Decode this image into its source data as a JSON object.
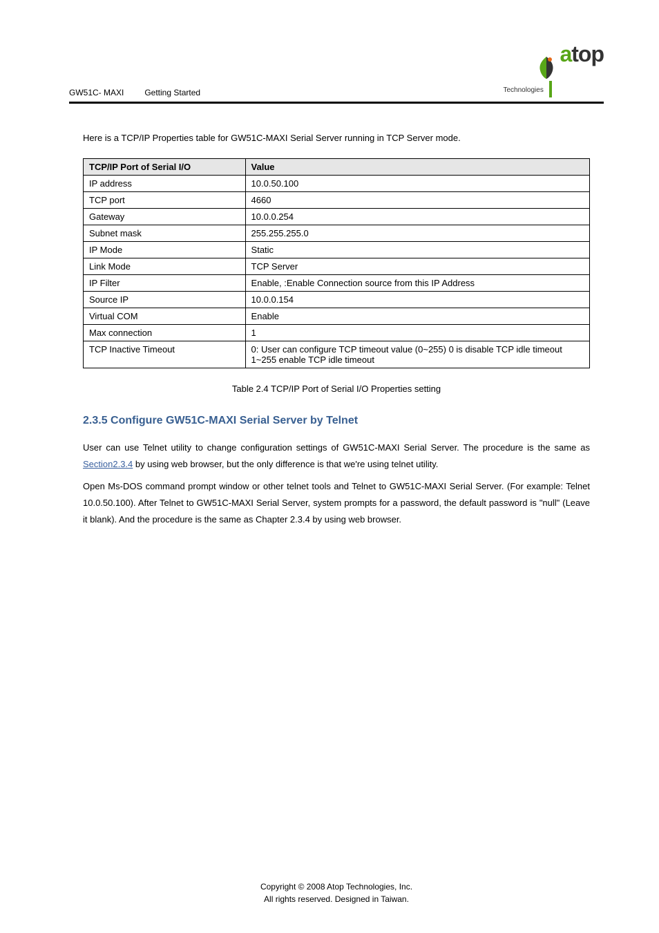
{
  "header": {
    "product": "GW51C- MAXI",
    "doc_title": "Getting Started",
    "logo_brand_a": "a",
    "logo_brand_top": "top",
    "logo_subtitle": "Technologies"
  },
  "intro": "Here is a TCP/IP Properties table for GW51C-MAXI Serial Server running in TCP Server mode.",
  "table": {
    "th_setting": "TCP/IP Port of Serial I/O",
    "th_value": "Value",
    "rows": [
      [
        "IP address",
        "10.0.50.100"
      ],
      [
        "TCP port",
        "4660"
      ],
      [
        "Gateway",
        "10.0.0.254"
      ],
      [
        "Subnet mask",
        "255.255.255.0"
      ],
      [
        "IP Mode",
        "Static"
      ],
      [
        "Link Mode",
        "TCP Server"
      ],
      [
        "IP Filter",
        "Enable, :Enable Connection source from this IP Address"
      ],
      [
        "Source IP",
        "10.0.0.154"
      ],
      [
        "Virtual COM",
        "Enable"
      ],
      [
        "Max connection",
        "1"
      ],
      [
        "TCP Inactive Timeout",
        "0: User can configure TCP timeout value (0~255) 0 is disable TCP idle timeout 1~255 enable TCP idle timeout"
      ]
    ]
  },
  "caption": "Table 2.4 TCP/IP Port of Serial I/O Properties setting",
  "section": {
    "heading": "2.3.5 Configure GW51C-MAXI Serial Server by Telnet",
    "para1_prefix": "User can use Telnet utility to change configuration settings of GW51C-MAXI Serial Server. The procedure is the same as ",
    "link_text": "Section2.3.4",
    "para1_suffix": " by using web browser, but the only difference is that we're using telnet utility.",
    "para2": "Open Ms-DOS command prompt window or other telnet tools and Telnet to GW51C-MAXI Serial Server. (For example: Telnet 10.0.50.100). After Telnet to GW51C-MAXI Serial Server, system prompts for a password, the default password is \"null\" (Leave it blank). And the procedure is the same as Chapter 2.3.4 by using web browser."
  },
  "footer": {
    "line1": "Copyright © 2008 Atop Technologies, Inc.",
    "line2": "All rights reserved. Designed in Taiwan."
  }
}
